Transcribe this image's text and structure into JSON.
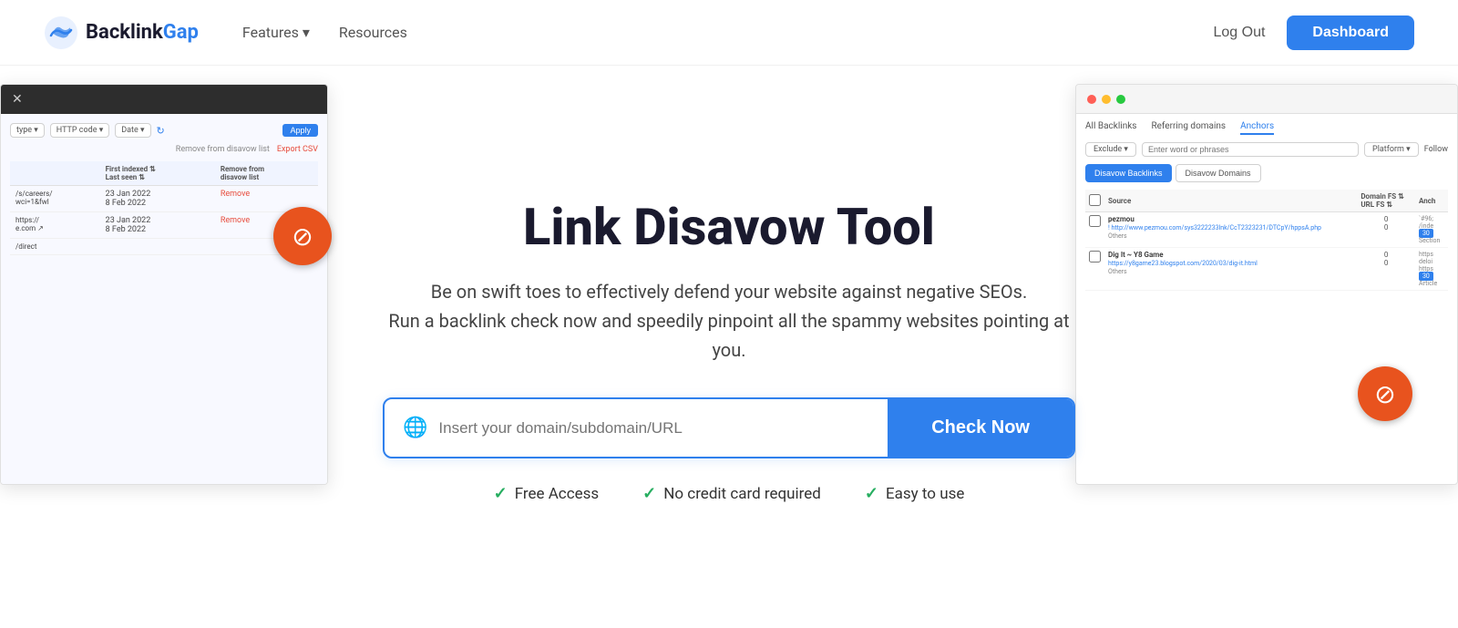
{
  "navbar": {
    "logo_text_dark": "Backlink",
    "logo_text_blue": "Gap",
    "features_label": "Features",
    "resources_label": "Resources",
    "logout_label": "Log Out",
    "dashboard_label": "Dashboard"
  },
  "hero": {
    "title": "Link Disavow Tool",
    "description_line1": "Be on swift toes to effectively defend your website against negative SEOs.",
    "description_line2": "Run a backlink check now and speedily pinpoint all the spammy websites pointing at you.",
    "input_placeholder": "Insert your domain/subdomain/URL",
    "check_now_label": "Check Now"
  },
  "features": [
    {
      "label": "Free Access"
    },
    {
      "label": "No credit card required"
    },
    {
      "label": "Easy to use"
    }
  ],
  "left_screenshot": {
    "filter_chips": [
      "type",
      "HTTP code",
      "Date"
    ],
    "apply_label": "Apply",
    "remove_label": "Remove from disavow list",
    "export_label": "Export CSV",
    "headers": [
      "First indexed / Last seen",
      "Remove from disavow list"
    ],
    "rows": [
      {
        "date1": "23 Jan 2022",
        "date2": "8 Feb 2022",
        "path": "/s/careers/\nwci=1&fwl",
        "action": "Remove"
      },
      {
        "date1": "23 Jan 2022",
        "date2": "8 Feb 2022",
        "url": "https://\ne.com",
        "action": "Remove",
        "path2": "/direct"
      }
    ]
  },
  "right_screenshot": {
    "tabs": [
      "All Backlinks",
      "Referring domains",
      "Anchors"
    ],
    "exclude_label": "Exclude",
    "search_placeholder": "Enter word or phrases",
    "platform_label": "Platform",
    "follow_label": "Follow",
    "disavow_backlinks_label": "Disavow Backlinks",
    "disavow_domains_label": "Disavow Domains",
    "headers": [
      "Source",
      "Domain FS / URL FS",
      "Anch"
    ],
    "rows": [
      {
        "name": "pezmou",
        "url": "http://www.pezmou.com/sys3222233lnk/CcT2323231/DTCpY/hppsA.php",
        "others": "Others",
        "fs": "0\n0",
        "anchor": "&#96;\n/inde\n30"
      },
      {
        "name": "Dig It ~ Y8 Game",
        "url": "https://y8game23.blogspot.com/2020/03/dig-it.html",
        "others": "Others",
        "fs": "0\n0",
        "anchor": "https\ndeloi\nhttps\n30\nArticle"
      }
    ]
  },
  "icons": {
    "ban": "⊘",
    "globe": "🌐",
    "chevron_down": "▾",
    "refresh": "↻",
    "check": "✓"
  },
  "colors": {
    "brand_blue": "#2f80ed",
    "orange": "#e8531e",
    "green": "#27ae60",
    "dark": "#1a1a2e"
  }
}
